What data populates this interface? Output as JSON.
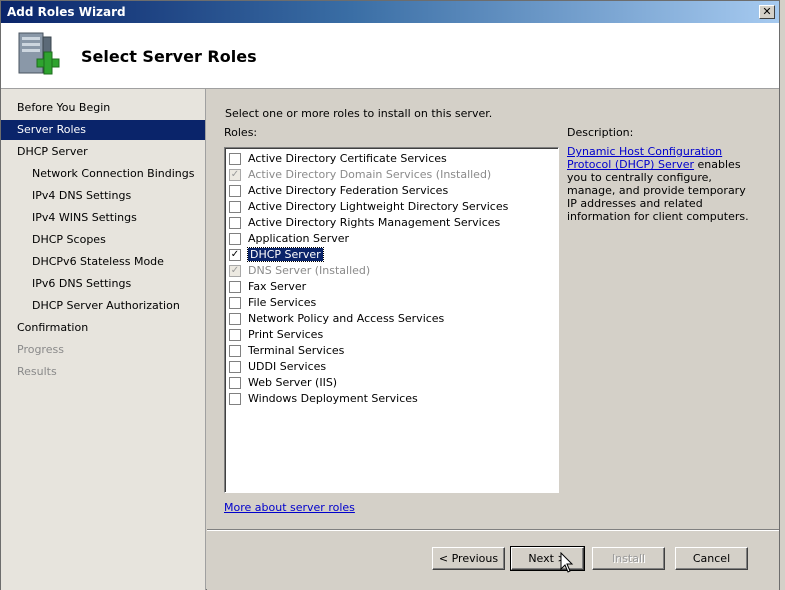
{
  "window": {
    "title": "Add Roles Wizard",
    "close_glyph": "✕"
  },
  "header": {
    "title": "Select Server Roles",
    "icon": "server-add-icon"
  },
  "nav": {
    "items": [
      {
        "label": "Before You Begin",
        "level": 0,
        "state": "normal"
      },
      {
        "label": "Server Roles",
        "level": 0,
        "state": "selected"
      },
      {
        "label": "DHCP Server",
        "level": 0,
        "state": "normal"
      },
      {
        "label": "Network Connection Bindings",
        "level": 1,
        "state": "normal"
      },
      {
        "label": "IPv4 DNS Settings",
        "level": 1,
        "state": "normal"
      },
      {
        "label": "IPv4 WINS Settings",
        "level": 1,
        "state": "normal"
      },
      {
        "label": "DHCP Scopes",
        "level": 1,
        "state": "normal"
      },
      {
        "label": "DHCPv6 Stateless Mode",
        "level": 1,
        "state": "normal"
      },
      {
        "label": "IPv6 DNS Settings",
        "level": 1,
        "state": "normal"
      },
      {
        "label": "DHCP Server Authorization",
        "level": 1,
        "state": "normal"
      },
      {
        "label": "Confirmation",
        "level": 0,
        "state": "normal"
      },
      {
        "label": "Progress",
        "level": 0,
        "state": "disabled"
      },
      {
        "label": "Results",
        "level": 0,
        "state": "disabled"
      }
    ]
  },
  "main": {
    "intro": "Select one or more roles to install on this server.",
    "roles_label": "Roles:",
    "roles": [
      {
        "label": "Active Directory Certificate Services",
        "checked": false,
        "installed": false
      },
      {
        "label": "Active Directory Domain Services  (Installed)",
        "checked": true,
        "installed": true
      },
      {
        "label": "Active Directory Federation Services",
        "checked": false,
        "installed": false
      },
      {
        "label": "Active Directory Lightweight Directory Services",
        "checked": false,
        "installed": false
      },
      {
        "label": "Active Directory Rights Management Services",
        "checked": false,
        "installed": false
      },
      {
        "label": "Application Server",
        "checked": false,
        "installed": false
      },
      {
        "label": "DHCP Server",
        "checked": true,
        "installed": false,
        "selected": true
      },
      {
        "label": "DNS Server  (Installed)",
        "checked": true,
        "installed": true
      },
      {
        "label": "Fax Server",
        "checked": false,
        "installed": false
      },
      {
        "label": "File Services",
        "checked": false,
        "installed": false,
        "grayed": true
      },
      {
        "label": "Network Policy and Access Services",
        "checked": false,
        "installed": false
      },
      {
        "label": "Print Services",
        "checked": false,
        "installed": false
      },
      {
        "label": "Terminal Services",
        "checked": false,
        "installed": false,
        "grayed": true
      },
      {
        "label": "UDDI Services",
        "checked": false,
        "installed": false
      },
      {
        "label": "Web Server (IIS)",
        "checked": false,
        "installed": false
      },
      {
        "label": "Windows Deployment Services",
        "checked": false,
        "installed": false,
        "grayed": true
      }
    ],
    "description_label": "Description:",
    "description_link": "Dynamic Host Configuration Protocol (DHCP) Server",
    "description_text": " enables you to centrally configure, manage, and provide temporary IP addresses and related information for client computers.",
    "more_link": "More about server roles"
  },
  "buttons": {
    "previous": "< Previous",
    "next": "Next >",
    "install": "Install",
    "cancel": "Cancel"
  },
  "colors": {
    "selection": "#0a246a",
    "link": "#0000cc",
    "face": "#d4d0c8"
  }
}
